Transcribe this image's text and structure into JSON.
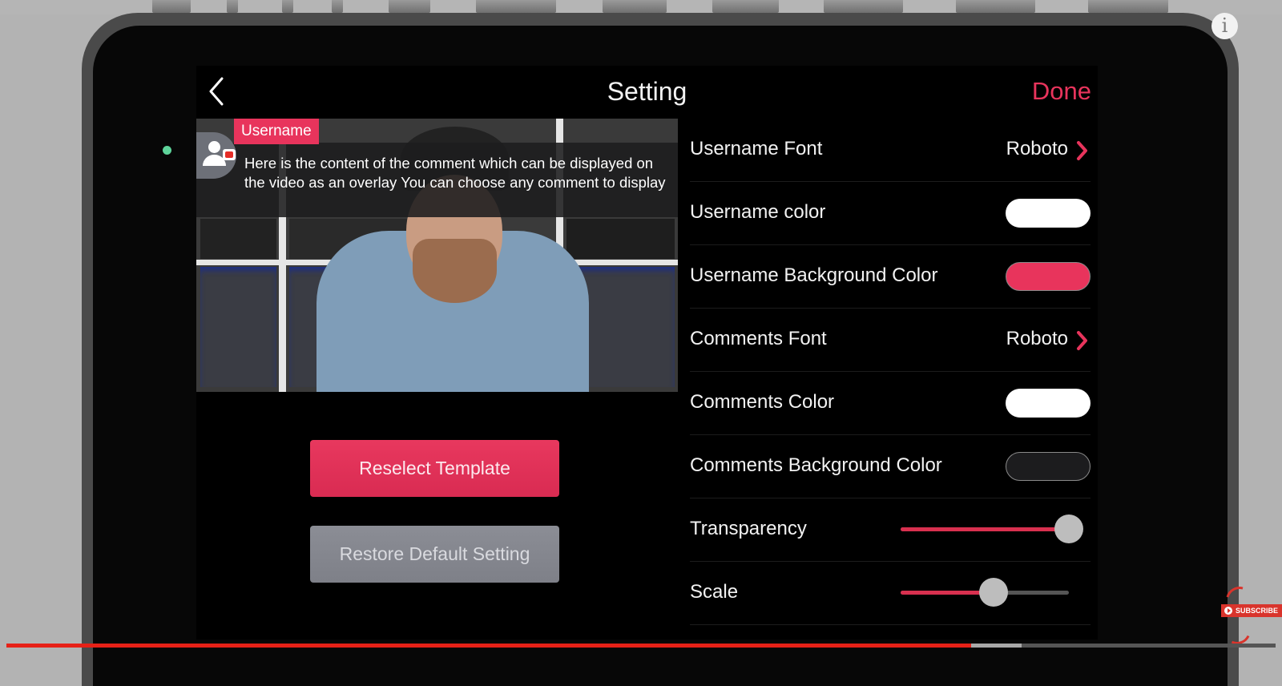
{
  "header": {
    "title": "Setting",
    "done_label": "Done"
  },
  "preview": {
    "username_badge": "Username",
    "comment_text": "Here is the content of the comment which can be displayed on the video as an overlay You can choose any comment to display"
  },
  "buttons": {
    "reselect_template": "Reselect Template",
    "restore_default": "Restore Default Setting"
  },
  "settings": {
    "username_font": {
      "label": "Username Font",
      "value": "Roboto"
    },
    "username_color": {
      "label": "Username color",
      "color": "#ffffff"
    },
    "username_bg_color": {
      "label": "Username Background Color",
      "color": "#e8345c"
    },
    "comments_font": {
      "label": "Comments Font",
      "value": "Roboto"
    },
    "comments_color": {
      "label": "Comments Color",
      "color": "#ffffff"
    },
    "comments_bg_color": {
      "label": "Comments Background Color",
      "color": "#1c1c1e"
    },
    "transparency": {
      "label": "Transparency",
      "value_fraction": 1.0
    },
    "scale": {
      "label": "Scale",
      "value_fraction": 0.55
    }
  },
  "colors": {
    "accent": "#e8345c",
    "secondary_button": "#868890",
    "status_led": "#5ed39a"
  },
  "video_overlay": {
    "info_icon": "i",
    "subscribe_label": "SUBSCRIBE",
    "progress_played_fraction": 0.76,
    "progress_buffered_fraction": 0.8
  }
}
